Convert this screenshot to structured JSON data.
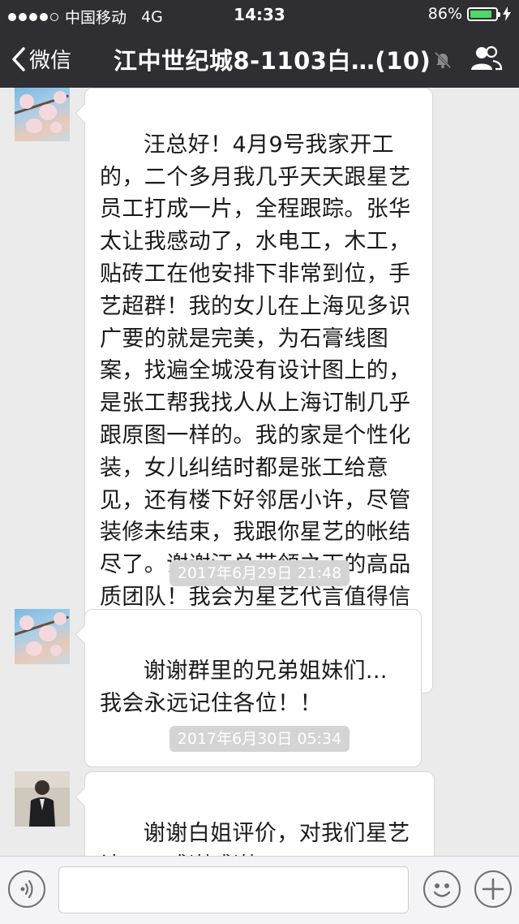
{
  "status_bar": {
    "carrier": "中国移动",
    "network": "4G",
    "time": "14:33",
    "battery": "86%",
    "battery_level": 0.86,
    "battery_color": "#4cd964"
  },
  "nav": {
    "back_label": "微信",
    "title": "江中世纪城8-1103白…(10)",
    "icons": [
      "chevron-left-icon",
      "mute-icon",
      "group-members-icon"
    ]
  },
  "messages": [
    {
      "type": "text",
      "avatar": "flower-avatar",
      "text": "汪总好！4月9号我家开工的，二个多月我几乎天天跟星艺员工打成一片，全程跟踪。张华太让我感动了，水电工，木工，贴砖工在他安排下非常到位，手艺超群！我的女儿在上海见多识广要的就是完美，为石膏线图案，找遍全城没有设计图上的，是张工帮我找人从上海订制几乎跟原图一样的。我的家是个性化装，女儿纠结时都是张工给意见，还有楼下好邻居小许，尽管装修未结束，我跟你星艺的帐结尽了。谢谢汪总带领之下的高品质团队！我会为星艺代言值得信赖！"
    },
    {
      "type": "timestamp",
      "text": "2017年6月29日 21:48"
    },
    {
      "type": "text",
      "avatar": "flower-avatar",
      "text": "谢谢群里的兄弟姐妹们...我会永远记住各位！！"
    },
    {
      "type": "timestamp",
      "text": "2017年6月30日 05:34"
    },
    {
      "type": "text",
      "avatar": "person-avatar",
      "text": "谢谢白姐评价，对我们星艺认可，感谢感谢，",
      "emoji": [
        "rose-icon",
        "rose-icon",
        "rose-icon",
        "rose-icon",
        "rose-icon",
        "rose-icon",
        "rose-icon",
        "rose-icon"
      ]
    }
  ],
  "input_bar": {
    "placeholder": "",
    "icons": [
      "voice-icon",
      "emoji-icon",
      "plus-icon"
    ]
  }
}
